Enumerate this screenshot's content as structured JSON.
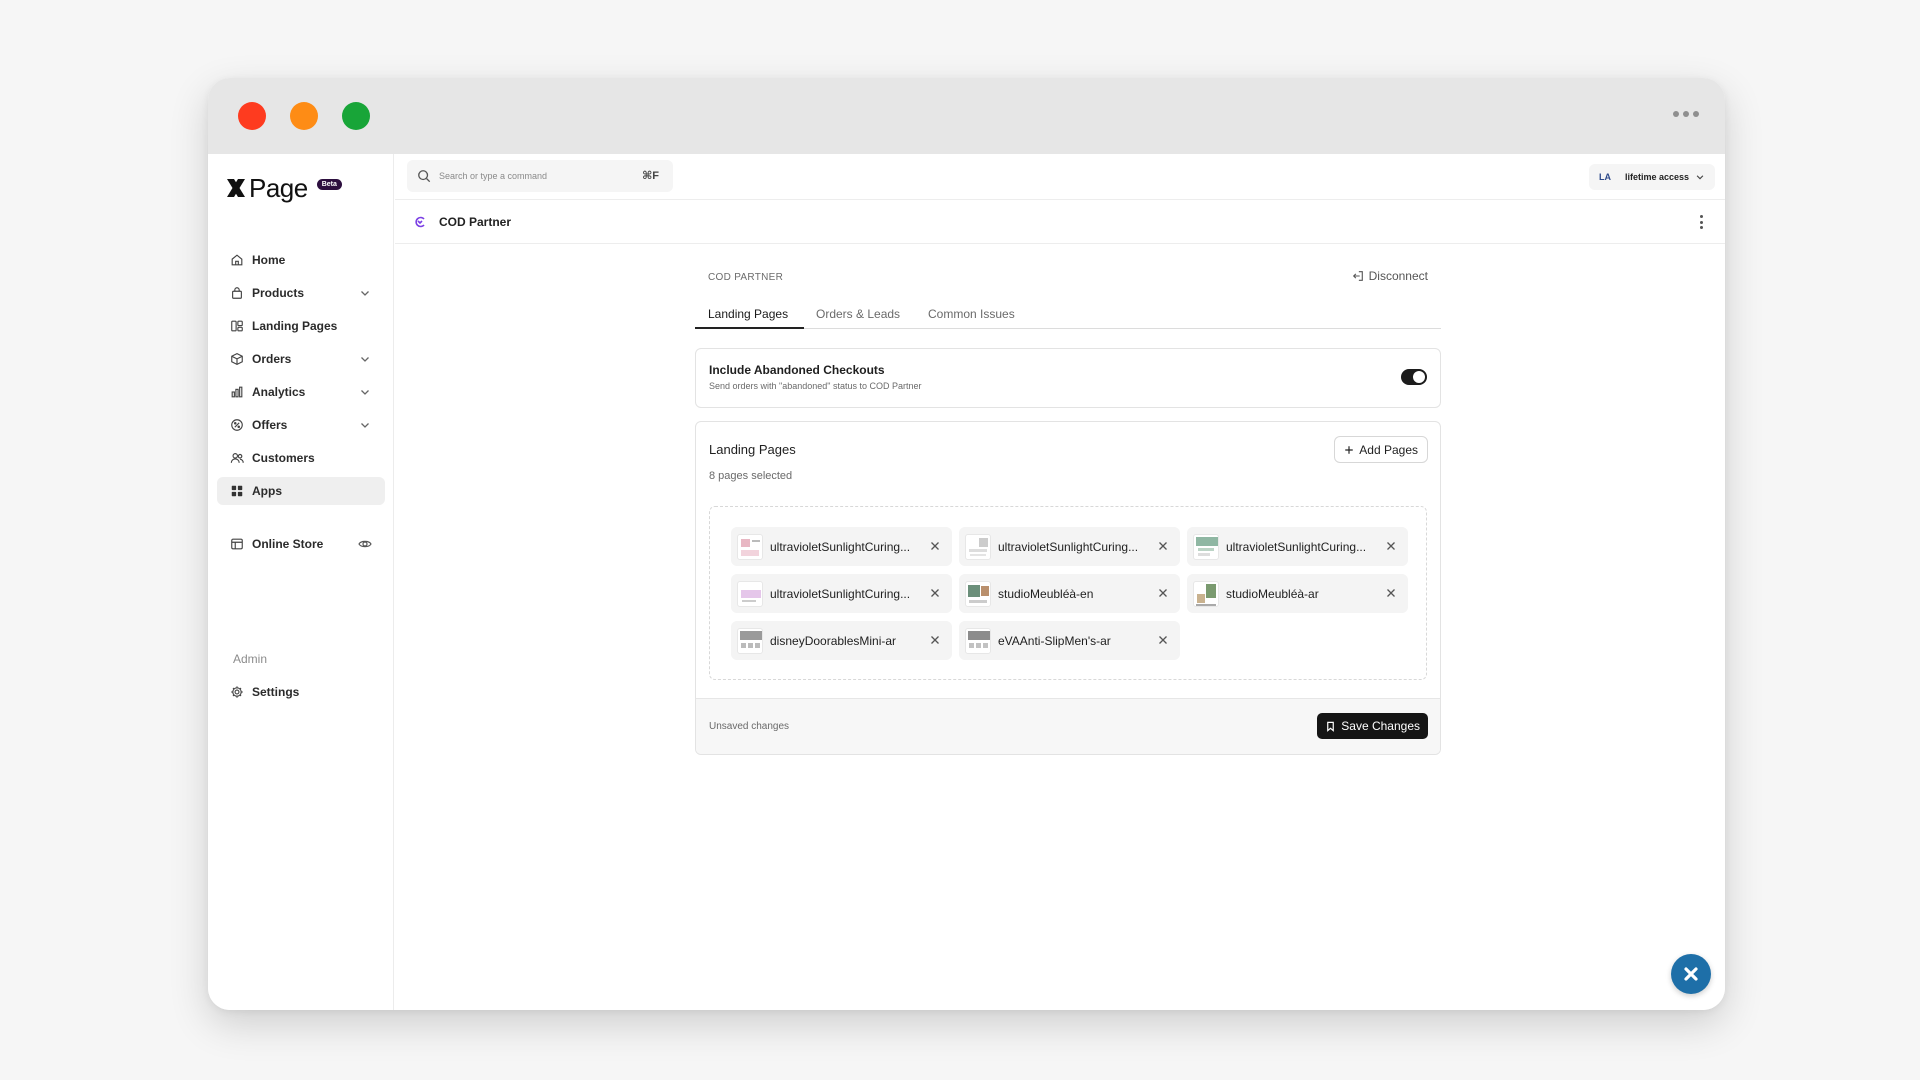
{
  "brand": {
    "name": "Page",
    "badge": "Beta"
  },
  "sidebar": {
    "items": [
      {
        "label": "Home",
        "icon": "home-icon"
      },
      {
        "label": "Products",
        "icon": "bag-icon",
        "expandable": true
      },
      {
        "label": "Landing Pages",
        "icon": "layout-icon"
      },
      {
        "label": "Orders",
        "icon": "box-icon",
        "expandable": true
      },
      {
        "label": "Analytics",
        "icon": "bar-chart-icon",
        "expandable": true
      },
      {
        "label": "Offers",
        "icon": "discount-icon",
        "expandable": true
      },
      {
        "label": "Customers",
        "icon": "users-icon"
      },
      {
        "label": "Apps",
        "icon": "grid-icon",
        "active": true
      },
      {
        "label": "Online Store",
        "icon": "store-icon"
      },
      {
        "label": "Settings",
        "icon": "gear-icon"
      }
    ],
    "admin_label": "Admin"
  },
  "topbar": {
    "search_placeholder": "Search or type a command",
    "shortcut": "⌘F",
    "account_initials": "LA",
    "account_label": "lifetime access"
  },
  "app": {
    "title": "COD Partner"
  },
  "panel": {
    "section_label": "COD PARTNER",
    "disconnect_label": "Disconnect",
    "tabs": [
      "Landing Pages",
      "Orders & Leads",
      "Common Issues"
    ],
    "active_tab": 0,
    "abandoned": {
      "title": "Include Abandoned Checkouts",
      "description": "Send orders with \"abandoned\" status to COD Partner",
      "enabled": true
    },
    "landing_pages": {
      "title": "Landing Pages",
      "selected_count": "8 pages selected",
      "add_label": "Add Pages",
      "pages": [
        {
          "label": "ultravioletSunlightCuring..."
        },
        {
          "label": "ultravioletSunlightCuring..."
        },
        {
          "label": "ultravioletSunlightCuring..."
        },
        {
          "label": "ultravioletSunlightCuring..."
        },
        {
          "label": "studioMeubléà-en"
        },
        {
          "label": "studioMeubléà-ar"
        },
        {
          "label": "disneyDoorablesMini-ar"
        },
        {
          "label": "eVAAnti-SlipMen's-ar"
        }
      ]
    },
    "footer": {
      "status": "Unsaved changes",
      "save_label": "Save Changes"
    }
  },
  "colors": {
    "accent": "#1e6fa8",
    "brand_badge": "#2d0f3f",
    "app_icon": "#7b3fe4"
  }
}
